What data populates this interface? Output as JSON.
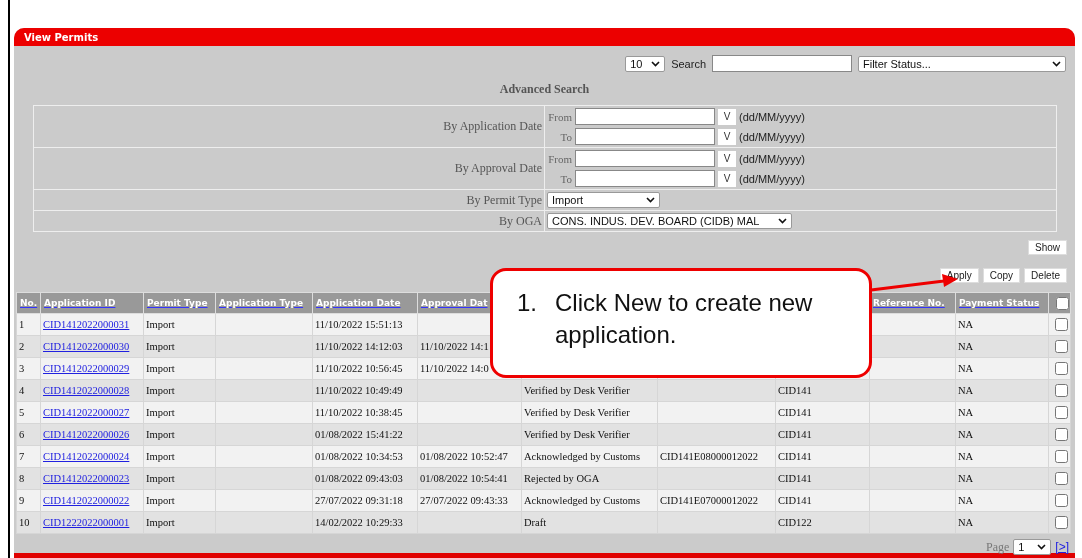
{
  "panel": {
    "title": "View Permits"
  },
  "toolbar": {
    "page_size": "10",
    "search_label": "Search",
    "filter_status": "Filter Status..."
  },
  "advanced_search": {
    "title": "Advanced Search",
    "date_filters": [
      {
        "label": "By Application Date",
        "rows": [
          {
            "label": "From",
            "picker": "V",
            "format": "(dd/MM/yyyy)"
          },
          {
            "label": "To",
            "picker": "V",
            "format": "(dd/MM/yyyy)"
          }
        ]
      },
      {
        "label": "By Approval Date",
        "rows": [
          {
            "label": "From",
            "picker": "V",
            "format": "(dd/MM/yyyy)"
          },
          {
            "label": "To",
            "picker": "V",
            "format": "(dd/MM/yyyy)"
          }
        ]
      }
    ],
    "select_filters": [
      {
        "label": "By Permit Type",
        "value": "Import"
      },
      {
        "label": "By OGA",
        "value": "CONS. INDUS. DEV. BOARD (CIDB) MAL"
      }
    ],
    "show_button": "Show"
  },
  "actions": [
    "Apply",
    "Copy",
    "Delete"
  ],
  "table": {
    "columns": [
      "No.",
      "Application ID",
      "Permit Type",
      "Application Type",
      "Application Date",
      "Approval Dat",
      null,
      null,
      null,
      "Reference No.",
      "Payment Status"
    ],
    "select_all": {
      "checked": false
    },
    "rows": [
      {
        "cells": [
          "1",
          "CID1412022000031",
          "Import",
          null,
          "11/10/2022 15:51:13",
          null,
          null,
          null,
          null,
          null,
          "NA"
        ],
        "checked": false
      },
      {
        "cells": [
          "2",
          "CID1412022000030",
          "Import",
          null,
          "11/10/2022 14:12:03",
          "11/10/2022 14:1",
          null,
          null,
          null,
          null,
          "NA"
        ],
        "checked": false
      },
      {
        "cells": [
          "3",
          "CID1412022000029",
          "Import",
          null,
          "11/10/2022 10:56:45",
          "11/10/2022 14:0",
          null,
          null,
          null,
          null,
          "NA"
        ],
        "checked": false
      },
      {
        "cells": [
          "4",
          "CID1412022000028",
          "Import",
          null,
          "11/10/2022 10:49:49",
          null,
          "Verified by Desk Verifier",
          null,
          "CID141",
          null,
          "NA"
        ],
        "checked": false
      },
      {
        "cells": [
          "5",
          "CID1412022000027",
          "Import",
          null,
          "11/10/2022 10:38:45",
          null,
          "Verified by Desk Verifier",
          null,
          "CID141",
          null,
          "NA"
        ],
        "checked": false
      },
      {
        "cells": [
          "6",
          "CID1412022000026",
          "Import",
          null,
          "01/08/2022 15:41:22",
          null,
          "Verified by Desk Verifier",
          null,
          "CID141",
          null,
          "NA"
        ],
        "checked": false
      },
      {
        "cells": [
          "7",
          "CID1412022000024",
          "Import",
          null,
          "01/08/2022 10:34:53",
          "01/08/2022 10:52:47",
          "Acknowledged by Customs",
          "CID141E08000012022",
          "CID141",
          null,
          "NA"
        ],
        "checked": false
      },
      {
        "cells": [
          "8",
          "CID1412022000023",
          "Import",
          null,
          "01/08/2022 09:43:03",
          "01/08/2022 10:54:41",
          "Rejected by OGA",
          null,
          "CID141",
          null,
          "NA"
        ],
        "checked": false
      },
      {
        "cells": [
          "9",
          "CID1412022000022",
          "Import",
          null,
          "27/07/2022 09:31:18",
          "27/07/2022 09:43:33",
          "Acknowledged by Customs",
          "CID141E07000012022",
          "CID141",
          null,
          "NA"
        ],
        "checked": false
      },
      {
        "cells": [
          "10",
          "CID1222022000001",
          "Import",
          null,
          "14/02/2022 10:29:33",
          null,
          "Draft",
          null,
          "CID122",
          null,
          "NA"
        ],
        "checked": false
      }
    ]
  },
  "pager": {
    "label": "Page",
    "page": "1",
    "next": "[>]"
  },
  "callout": {
    "number": "1.",
    "text": "Click New to create new application."
  }
}
